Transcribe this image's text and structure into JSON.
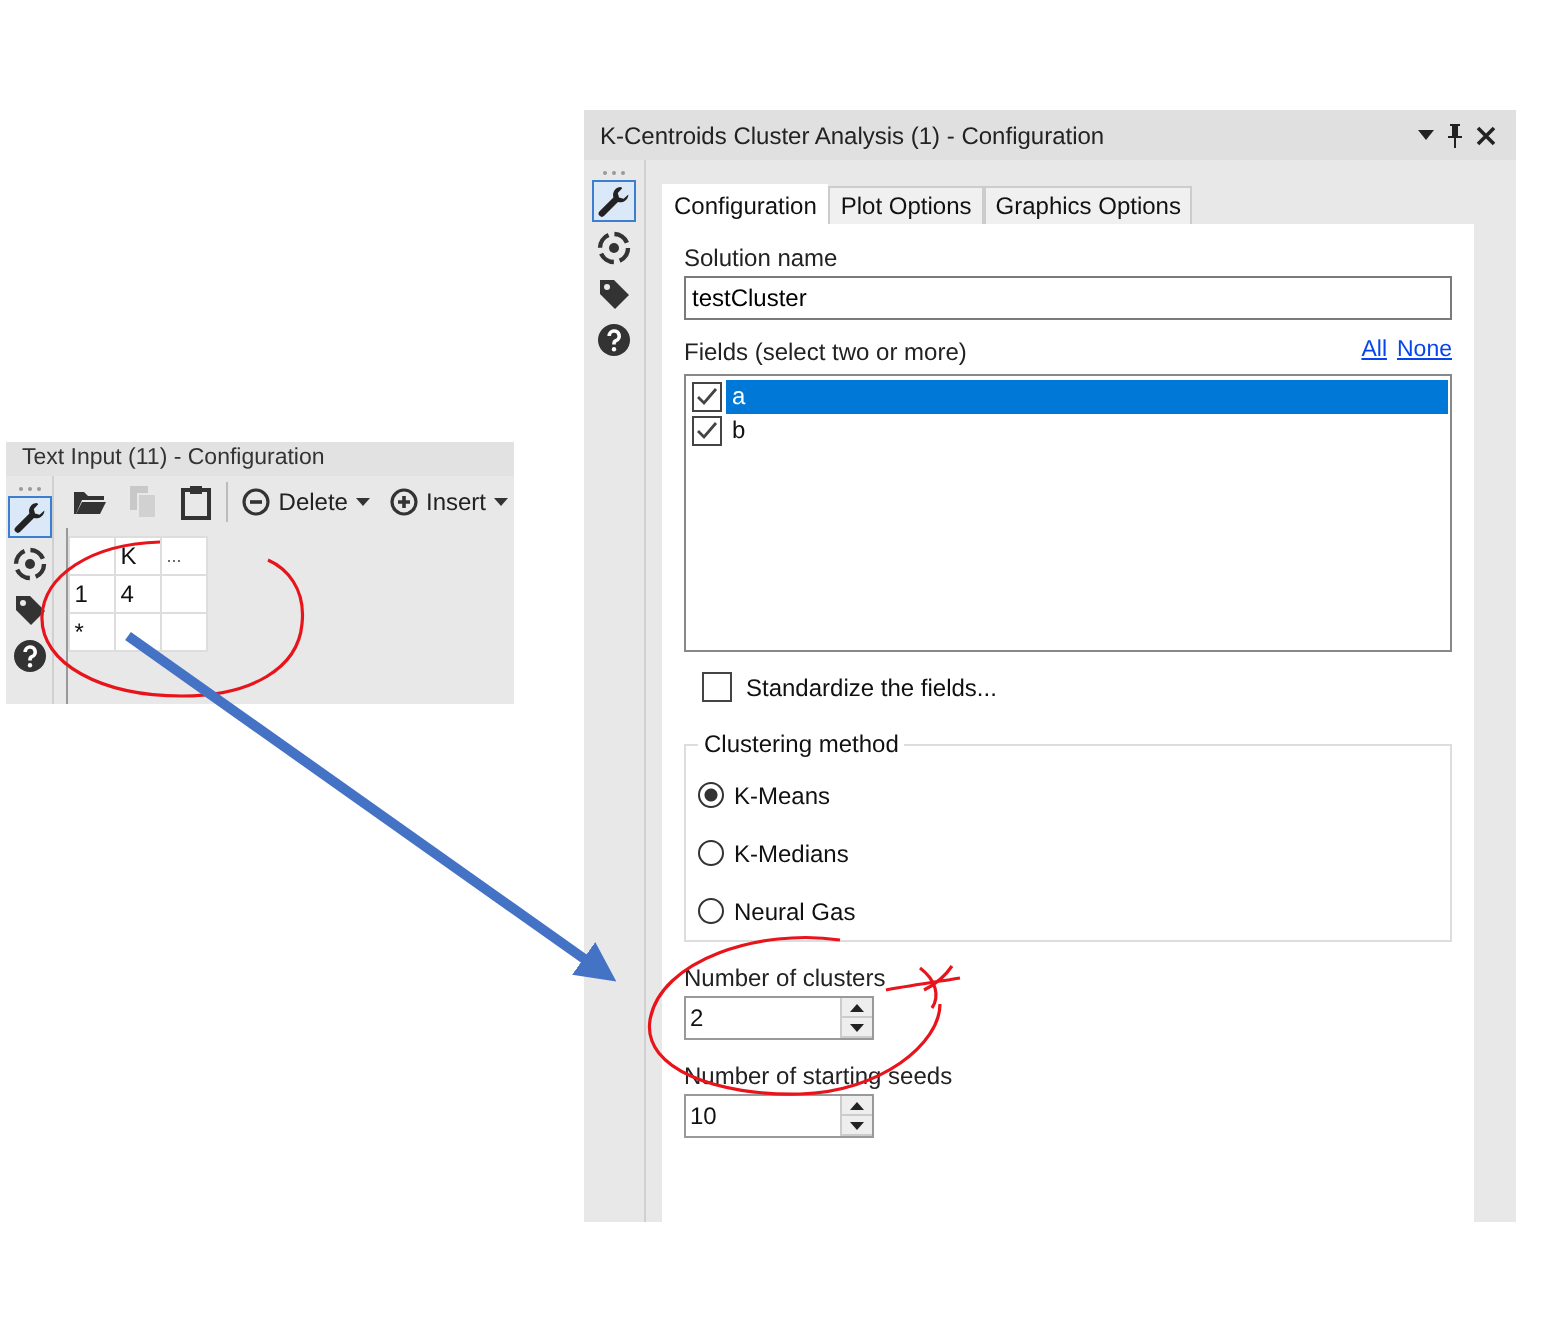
{
  "text_input_panel": {
    "title": "Text Input (11) - Configuration",
    "tools": [
      {
        "kind": "wrench",
        "selected": true
      },
      {
        "kind": "target",
        "selected": false
      },
      {
        "kind": "tag",
        "selected": false
      },
      {
        "kind": "help",
        "selected": false
      }
    ],
    "toolbar": [
      {
        "kind": "open",
        "disabled": false
      },
      {
        "kind": "copy",
        "disabled": true
      },
      {
        "kind": "paste",
        "disabled": false
      },
      {
        "kind": "delete",
        "label": "Delete",
        "disabled": false
      },
      {
        "kind": "insert",
        "label": "Insert",
        "disabled": false
      }
    ],
    "grid": {
      "columns": [
        "K",
        "..."
      ],
      "rows": [
        {
          "number": "1",
          "cells": [
            "4"
          ]
        },
        {
          "number": "*"
        }
      ]
    }
  },
  "cluster_panel": {
    "title": "K-Centroids Cluster Analysis (1) - Configuration",
    "tools": [
      {
        "kind": "wrench",
        "selected": true
      },
      {
        "kind": "target",
        "selected": false
      },
      {
        "kind": "tag",
        "selected": false
      },
      {
        "kind": "help",
        "selected": false
      }
    ],
    "tabs": [
      {
        "label": "Configuration",
        "selected": true
      },
      {
        "label": "Plot Options",
        "selected": false
      },
      {
        "label": "Graphics Options",
        "selected": false
      }
    ],
    "solution_name": {
      "label": "Solution name",
      "value": "testCluster"
    },
    "fields": {
      "label": "Fields (select two or more)",
      "links": [
        "All",
        "None"
      ],
      "items": [
        {
          "label": "a",
          "checked": true,
          "selected": true
        },
        {
          "label": "b",
          "checked": true,
          "selected": false
        }
      ]
    },
    "standardize": {
      "label": "Standardize the fields...",
      "checked": false
    },
    "clustering_method": {
      "label": "Clustering method",
      "options": [
        {
          "label": "K-Means",
          "selected": true
        },
        {
          "label": "K-Medians",
          "selected": false
        },
        {
          "label": "Neural Gas",
          "selected": false
        }
      ]
    },
    "number_of_clusters": {
      "label": "Number of clusters",
      "value": "2"
    },
    "starting_seeds": {
      "label": "Number of starting seeds",
      "value": "10"
    }
  }
}
